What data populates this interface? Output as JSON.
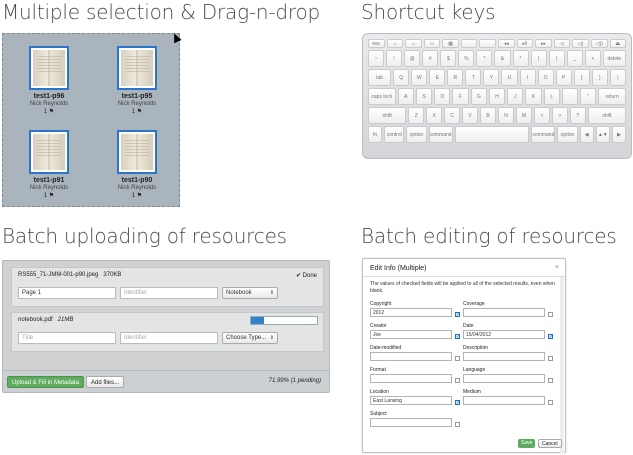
{
  "headings": {
    "multi": "Multiple selection & Drag-n-drop",
    "shortcut": "Shortcut keys",
    "upload": "Batch uploading of resources",
    "edit": "Batch editing of resources"
  },
  "selection": {
    "items": [
      {
        "title": "test1-p96",
        "owner": "Nick Reynolds",
        "meta": "1 ⚑"
      },
      {
        "title": "test1-p95",
        "owner": "Nick Reynolds",
        "meta": "1 ⚑"
      },
      {
        "title": "test1-p91",
        "owner": "Nick Reynolds",
        "meta": "1 ⚑"
      },
      {
        "title": "test1-p90",
        "owner": "Nick Reynolds",
        "meta": "1 ⚑"
      }
    ]
  },
  "keyboard": {
    "row_fn": [
      "esc",
      "☼",
      "☼",
      "▭",
      "▦",
      "",
      "",
      "◂◂",
      "▸ll",
      "▸▸",
      "◁",
      "◁)",
      "◁))",
      "⏏"
    ],
    "row_num": [
      "~",
      "!",
      "@",
      "#",
      "$",
      "%",
      "^",
      "&",
      "*",
      "(",
      ")",
      "_",
      "+",
      "delete"
    ],
    "row_q": [
      "tab",
      "Q",
      "W",
      "E",
      "R",
      "T",
      "Y",
      "U",
      "I",
      "O",
      "P",
      "{",
      "}",
      "|"
    ],
    "row_a": [
      "caps lock",
      "A",
      "S",
      "D",
      "F",
      "G",
      "H",
      "J",
      "K",
      "L",
      ":",
      "\"",
      "return"
    ],
    "row_z": [
      "shift",
      "Z",
      "X",
      "C",
      "V",
      "B",
      "N",
      "M",
      "<",
      ">",
      "?",
      "shift"
    ],
    "row_bottom": [
      "fn",
      "control",
      "option",
      "command",
      "",
      "command",
      "option",
      "◀",
      "▲▼",
      "▶"
    ]
  },
  "upload": {
    "file1": {
      "name": "RS555_71-JMM-001-p90.jpeg",
      "size": "370KB",
      "status": "✔ Done",
      "title_value": "Page 1",
      "identifier_placeholder": "Identifier",
      "type_value": "Notebook"
    },
    "file2": {
      "name": "notebook.pdf",
      "size": "21MB",
      "progress": 0.19,
      "title_placeholder": "Title",
      "identifier_placeholder": "Identifier",
      "type_value": "Choose Type..."
    },
    "upload_button": "Upload & Fill in Metadata",
    "add_button": "Add files...",
    "status": "71.99% (1 pending)"
  },
  "edit": {
    "title": "Edit Info (Multiple)",
    "close": "×",
    "note": "The values of checked fields will be applied to all of the selected results, even when blank.",
    "fields_left": [
      {
        "label": "Copyright",
        "value": "2012",
        "checked": true
      },
      {
        "label": "Creator",
        "value": "Joe",
        "checked": true
      },
      {
        "label": "Date-modified",
        "value": "",
        "checked": false
      },
      {
        "label": "Format",
        "value": "",
        "checked": false
      },
      {
        "label": "Location",
        "value": "East Lansing",
        "checked": true
      },
      {
        "label": "Subject",
        "value": "",
        "checked": false
      }
    ],
    "fields_right": [
      {
        "label": "Coverage",
        "value": "",
        "checked": false
      },
      {
        "label": "Date",
        "value": "15/04/2012",
        "checked": true
      },
      {
        "label": "Description",
        "value": "",
        "checked": false
      },
      {
        "label": "Language",
        "value": "",
        "checked": false
      },
      {
        "label": "Medium",
        "value": "",
        "checked": false
      }
    ],
    "save": "Save",
    "cancel": "Cancel"
  }
}
